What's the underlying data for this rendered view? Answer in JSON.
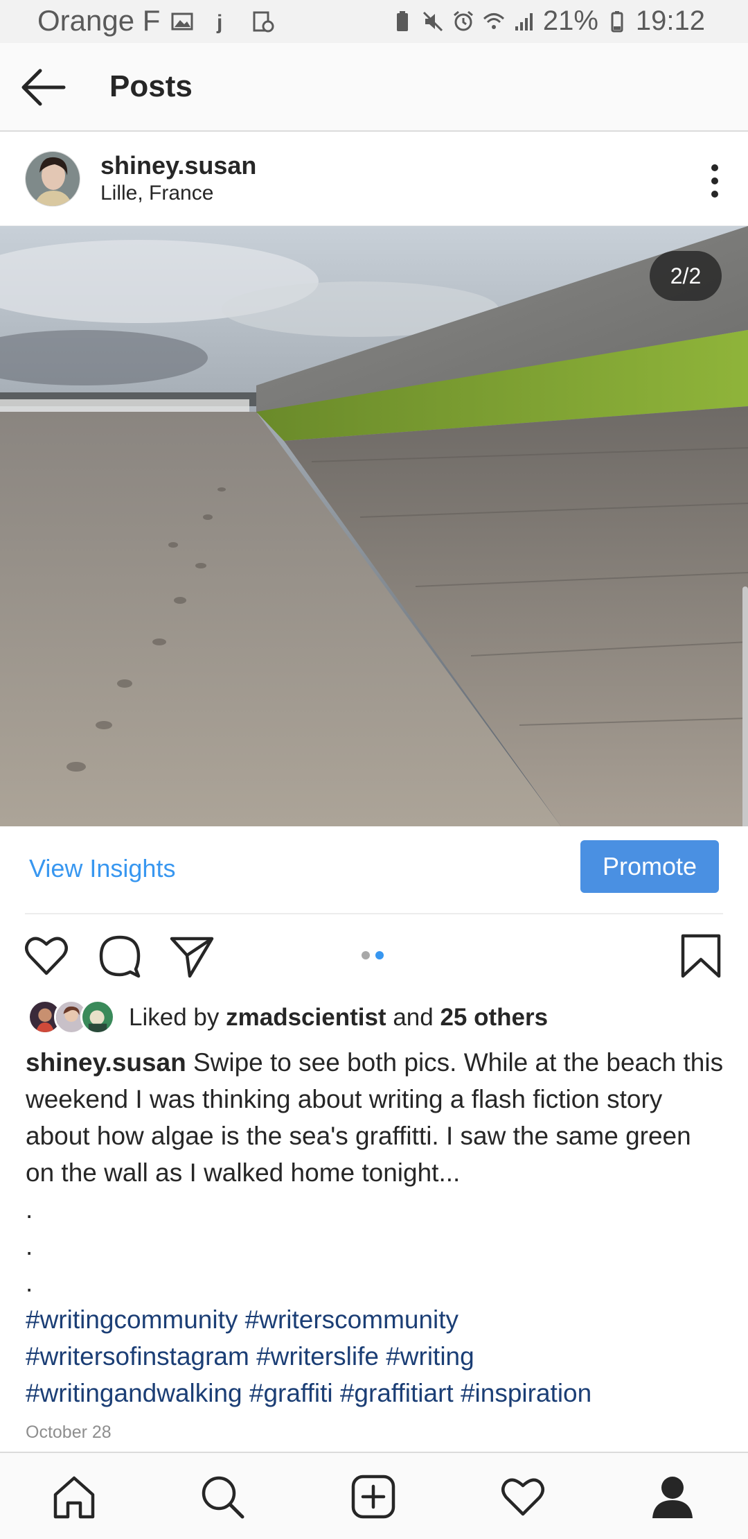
{
  "status_bar": {
    "carrier": "Orange F",
    "battery": "21%",
    "time": "19:12"
  },
  "header": {
    "title": "Posts"
  },
  "post": {
    "username": "shiney.susan",
    "location": "Lille, France",
    "image_counter": "2/2",
    "carousel_total": 2,
    "carousel_current": 2
  },
  "insights": {
    "view_label": "View Insights",
    "promote_label": "Promote"
  },
  "likes": {
    "prefix": "Liked by",
    "liker": "zmadscientist",
    "middle": "and",
    "others": "25 others"
  },
  "caption": {
    "user": "shiney.susan",
    "text": "Swipe to see both pics. While at the beach this weekend I was thinking about writing a flash fiction story about how algae is the sea's graffitti. I saw the same green on the wall as I walked home tonight...",
    "dots": [
      ".",
      ".",
      "."
    ],
    "hashtags": [
      "#writingcommunity #writerscommunity",
      "#writersofinstagram #writerslife #writing",
      "#writingandwalking #graffiti #graffitiart #inspiration"
    ]
  },
  "date": "October 28",
  "colors": {
    "link_blue": "#3897f0",
    "promote_blue": "#4a90e2",
    "hashtag_navy": "#1b3e75"
  },
  "icons": {
    "back": "arrow-left-icon",
    "more": "more-vertical-icon",
    "like": "heart-outline-icon",
    "comment": "comment-bubble-icon",
    "share": "paper-plane-icon",
    "save": "bookmark-icon",
    "nav": [
      "home-icon",
      "search-icon",
      "add-post-icon",
      "activity-heart-icon",
      "profile-icon"
    ]
  }
}
